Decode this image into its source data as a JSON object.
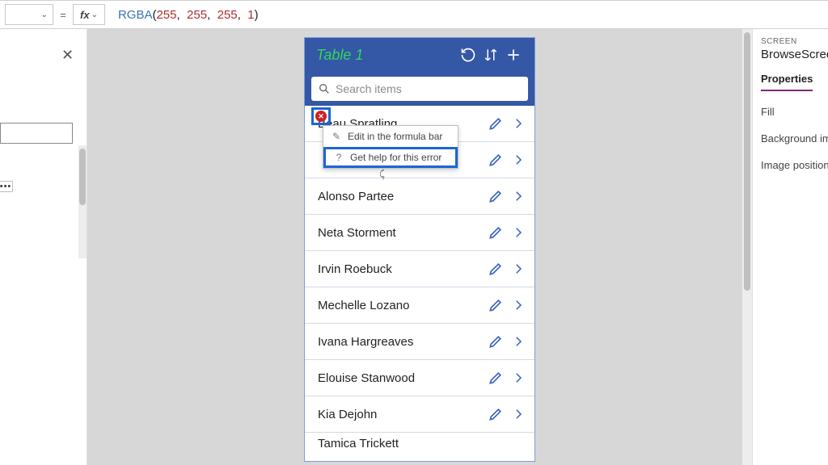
{
  "formula_bar": {
    "eq": "=",
    "fx": "fx",
    "fn": "RGBA",
    "open": "(",
    "close": ")",
    "sep": ",",
    "args": [
      "255",
      "255",
      "255",
      "1"
    ]
  },
  "app": {
    "title": "Table 1",
    "search_placeholder": "Search items"
  },
  "list_items": [
    "Beau Spratling",
    "",
    "Alonso Partee",
    "Neta Storment",
    "Irvin Roebuck",
    "Mechelle Lozano",
    "Ivana Hargreaves",
    "Elouise Stanwood",
    "Kia Dejohn",
    "Tamica Trickett"
  ],
  "context_menu": {
    "edit": "Edit in the formula bar",
    "help": "Get help for this error"
  },
  "props": {
    "chip": "SCREEN",
    "name": "BrowseScreen",
    "tab": "Properties",
    "fill": "Fill",
    "bgimg": "Background ima",
    "imgpos": "Image position"
  }
}
